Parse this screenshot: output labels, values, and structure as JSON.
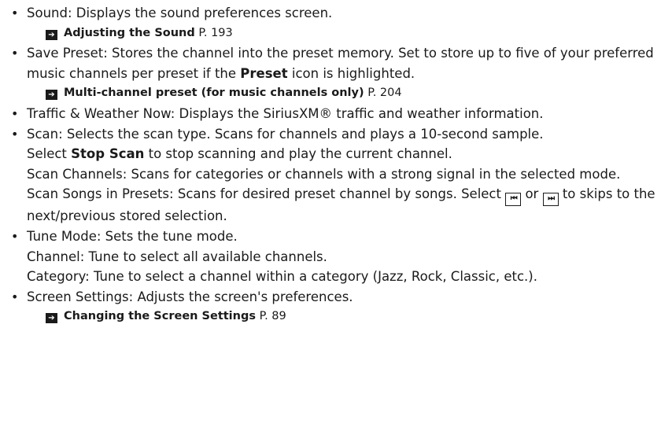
{
  "bullet_char": "•",
  "arrow_glyph": "➔",
  "sound": {
    "term": "Sound",
    "desc": ": Displays the sound preferences screen.",
    "ref_title": "Adjusting the Sound",
    "ref_page": " P. 193"
  },
  "save_preset": {
    "term": "Save Preset",
    "desc_1": ": Stores the channel into the preset memory. Set to store up to five of your preferred music channels per preset if the ",
    "preset_word": "Preset",
    "desc_2": " icon is highlighted.",
    "ref_title": "Multi-channel preset (for music channels only)",
    "ref_page": " P. 204"
  },
  "traffic": {
    "term": "Traffic & Weather Now",
    "desc": ": Displays the SiriusXM® traffic and weather information."
  },
  "scan": {
    "term": "Scan",
    "desc": ": Selects the scan type. Scans for channels and plays a 10-second sample.",
    "select_text": "Select ",
    "stop_scan": "Stop Scan",
    "stop_desc": " to stop scanning and play the current channel.",
    "scan_channels": "Scan Channels",
    "scan_channels_desc": ": Scans for categories or channels with a strong signal in the selected mode.",
    "scan_songs": "Scan Songs in Presets",
    "scan_songs_desc": ": Scans for desired preset channel by songs. Select ",
    "or_text": " or",
    "skip_desc": " to skips to the next/previous stored selection.",
    "prev_icon_glyph": "⏮",
    "next_icon_glyph": "⏭"
  },
  "tune_mode": {
    "term": "Tune Mode",
    "desc": ": Sets the tune mode.",
    "channel": "Channel",
    "channel_desc": ": Tune to select all available channels.",
    "category": "Category",
    "category_desc": ": Tune to select a channel within a category (Jazz, Rock, Classic, etc.)."
  },
  "screen_settings": {
    "term": "Screen Settings",
    "desc": ": Adjusts the screen's preferences.",
    "ref_title": "Changing the Screen Settings",
    "ref_page": " P. 89"
  }
}
